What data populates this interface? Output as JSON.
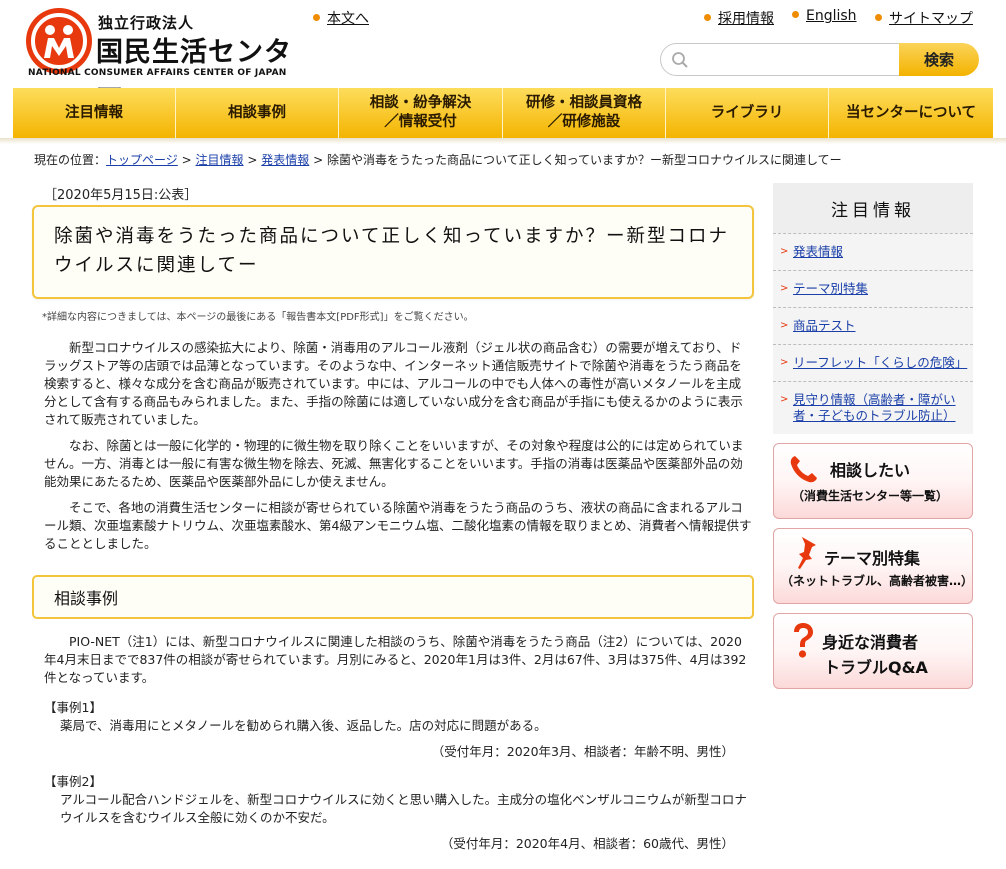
{
  "header": {
    "logo_small": "独立行政法人",
    "logo_big": "国民生活センター",
    "logo_en": "NATIONAL CONSUMER AFFAIRS CENTER OF JAPAN",
    "skip_link": "本文へ",
    "links": [
      "採用情報",
      "English",
      "サイトマップ"
    ],
    "search_placeholder": "",
    "search_button": "検索"
  },
  "nav": [
    "注目情報",
    "相談事例",
    "相談・紛争解決\n／情報受付",
    "研修・相談員資格\n／研修施設",
    "ライブラリ",
    "当センターについて"
  ],
  "breadcrumb": {
    "prefix": "現在の位置：",
    "links": [
      "トップページ",
      "注目情報",
      "発表情報"
    ],
    "current": "除菌や消毒をうたった商品について正しく知っていますか？ー新型コロナウイルスに関連してー",
    "separator": ">"
  },
  "main": {
    "date": "［2020年5月15日:公表］",
    "title": "除菌や消毒をうたった商品について正しく知っていますか？ー新型コロナウイルスに関連してー",
    "note": "*詳細な内容につきましては、本ページの最後にある「報告書本文[PDF形式]」をご覧ください。",
    "paragraphs": [
      "新型コロナウイルスの感染拡大により、除菌・消毒用のアルコール液剤（ジェル状の商品含む）の需要が増えており、ドラッグストア等の店頭では品薄となっています。そのような中、インターネット通信販売サイトで除菌や消毒をうたう商品を検索すると、様々な成分を含む商品が販売されています。中には、アルコールの中でも人体への毒性が高いメタノールを主成分として含有する商品もみられました。また、手指の除菌には適していない成分を含む商品が手指にも使えるかのように表示されて販売されていました。",
      "なお、除菌とは一般に化学的・物理的に微生物を取り除くことをいいますが、その対象や程度は公的には定められていません。一方、消毒とは一般に有害な微生物を除去、死滅、無害化することをいいます。手指の消毒は医薬品や医薬部外品の効能効果にあたるため、医薬品や医薬部外品にしか使えません。",
      "そこで、各地の消費生活センターに相談が寄せられている除菌や消毒をうたう商品のうち、液状の商品に含まれるアルコール類、次亜塩素酸ナトリウム、次亜塩素酸水、第4級アンモニウム塩、二酸化塩素の情報を取りまとめ、消費者へ情報提供することとしました。"
    ],
    "section_title": "相談事例",
    "section_para": "PIO-NET（注1）には、新型コロナウイルスに関連した相談のうち、除菌や消毒をうたう商品（注2）については、2020年4月末日までで837件の相談が寄せられています。月別にみると、2020年1月は3件、2月は67件、3月は375件、4月は392件となっています。",
    "cases": [
      {
        "label": "【事例1】",
        "text": "薬局で、消毒用にとメタノールを勧められ購入後、返品した。店の対応に問題がある。",
        "meta": "（受付年月：2020年3月、相談者：年齢不明、男性）"
      },
      {
        "label": "【事例2】",
        "text": "アルコール配合ハンドジェルを、新型コロナウイルスに効くと思い購入した。主成分の塩化ベンザルコニウムが新型コロナウイルスを含むウイルス全般に効くのか不安だ。",
        "meta": "（受付年月：2020年4月、相談者：60歳代、男性）"
      }
    ]
  },
  "sidebar": {
    "heading": "注目情報",
    "items": [
      "発表情報",
      "テーマ別特集",
      "商品テスト",
      "リーフレット「くらしの危険」",
      "見守り情報（高齢者・障がい者・子どものトラブル防止）"
    ],
    "ctas": [
      {
        "title": "相談したい",
        "sub": "（消費生活センター等一覧）",
        "icon": "phone-icon"
      },
      {
        "title": "テーマ別特集",
        "sub": "（ネットトラブル、高齢者被害…）",
        "icon": "pushpin-icon"
      },
      {
        "title": "身近な消費者",
        "sub": "トラブルQ&A",
        "icon": "question-mark-icon"
      }
    ]
  },
  "colors": {
    "accent_orange": "#f08c00",
    "nav_yellow": "#f4b400",
    "box_border": "#f2c53d",
    "logo_red": "#e8380d",
    "link_blue": "#1a3fa8"
  }
}
